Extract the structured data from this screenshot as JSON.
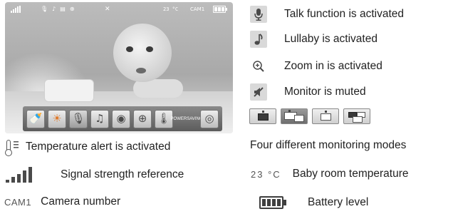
{
  "screen": {
    "status_bar": {
      "temperature": "23 °C",
      "camera": "CAM1",
      "icons": [
        "signal-icon",
        "microphone-icon",
        "music-note-icon",
        "thermometer-icon",
        "zoom-icon",
        "mute-icon",
        "battery-icon"
      ]
    },
    "menu": [
      {
        "name": "bottle-icon",
        "glyph": "🍼"
      },
      {
        "name": "brightness-icon",
        "glyph": "☀"
      },
      {
        "name": "talk-icon",
        "glyph": "🎙"
      },
      {
        "name": "lullaby-icon",
        "glyph": "♫"
      },
      {
        "name": "camera-icon",
        "glyph": "◉"
      },
      {
        "name": "zoom-icon",
        "glyph": "🔍"
      },
      {
        "name": "temperature-icon",
        "glyph": "🌡"
      },
      {
        "name": "power-saving-icon",
        "label": "POWER\nSAVING"
      },
      {
        "name": "settings-icon",
        "glyph": "⚙"
      }
    ],
    "power_saving_label_1": "POWER",
    "power_saving_label_2": "SAVING"
  },
  "legend": {
    "talk": {
      "icon": "microphone-icon",
      "label": "Talk function is activated"
    },
    "lullaby": {
      "icon": "music-note-icon",
      "label": "Lullaby is activated"
    },
    "zoom": {
      "icon": "zoom-in-icon",
      "label": "Zoom in is activated"
    },
    "mute": {
      "icon": "speaker-muted-icon",
      "label": "Monitor is muted"
    },
    "modes": {
      "label": "Four different monitoring modes",
      "count": 4
    },
    "temp_alert": {
      "icon": "thermometer-icon",
      "label": "Temperature alert is activated"
    },
    "signal": {
      "icon": "signal-strength-icon",
      "label": "Signal strength reference",
      "level": 5
    },
    "camera": {
      "chip": "CAM1",
      "label": "Camera number"
    },
    "room_temp": {
      "chip": "23 °C",
      "label": "Baby room temperature"
    },
    "battery": {
      "icon": "battery-icon",
      "label": "Battery level",
      "level": "full"
    }
  }
}
